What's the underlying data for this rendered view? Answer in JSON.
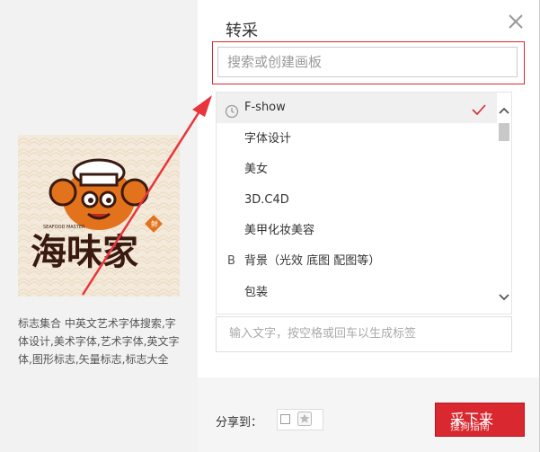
{
  "dialog": {
    "title": "转采"
  },
  "pin": {
    "description": "标志集合 中英文艺术字体搜索,字体设计,美术字体,艺术字体,英文字体,图形标志,矢量标志,标志大全",
    "logo_text": "海味家",
    "logo_small_text": "SEAFOOD MASTER"
  },
  "search": {
    "placeholder": "搜索或创建画板"
  },
  "boards": {
    "items": [
      {
        "label": "F-show",
        "selected": true
      },
      {
        "label": "字体设计"
      },
      {
        "label": "美女"
      },
      {
        "label": "3D.C4D"
      },
      {
        "label": "美甲化妆美容"
      },
      {
        "group": "B",
        "label": "背景（光效 底图 配图等）"
      },
      {
        "label": "包装"
      }
    ]
  },
  "tags": {
    "placeholder": "输入文字，按空格或回车以生成标签"
  },
  "footer": {
    "share_label": "分享到：",
    "submit_label": "采下来",
    "watermark": "搜狗指南"
  },
  "colors": {
    "accent": "#d9282f",
    "annotation": "#e8353b"
  }
}
